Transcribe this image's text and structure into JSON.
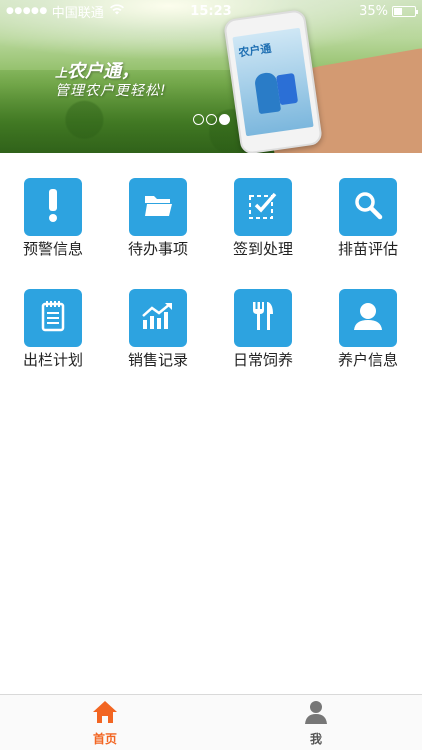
{
  "status_bar": {
    "signal": "●●●●●",
    "carrier": "中国联通",
    "time": "15:23",
    "battery": "35%"
  },
  "banner": {
    "slogan_line1_prefix": "上",
    "slogan_line1_brand": "农户通",
    "slogan_line1_suffix": "，",
    "slogan_line2": "管理农户更轻松!",
    "phone_screen_title": "农户通",
    "pager_count": 3,
    "pager_active_index": 2
  },
  "menu": {
    "items": [
      {
        "label": "预警信息",
        "icon": "exclamation-icon"
      },
      {
        "label": "待办事项",
        "icon": "folder-icon"
      },
      {
        "label": "签到处理",
        "icon": "checkbox-icon"
      },
      {
        "label": "排苗评估",
        "icon": "search-icon"
      },
      {
        "label": "出栏计划",
        "icon": "notepad-icon"
      },
      {
        "label": "销售记录",
        "icon": "trend-chart-icon"
      },
      {
        "label": "日常饲养",
        "icon": "fork-knife-icon"
      },
      {
        "label": "养户信息",
        "icon": "user-icon"
      }
    ]
  },
  "tabbar": {
    "home_label": "首页",
    "me_label": "我"
  },
  "colors": {
    "tile": "#2da3e0",
    "active_tab": "#f26522",
    "inactive_tab": "#777777"
  }
}
